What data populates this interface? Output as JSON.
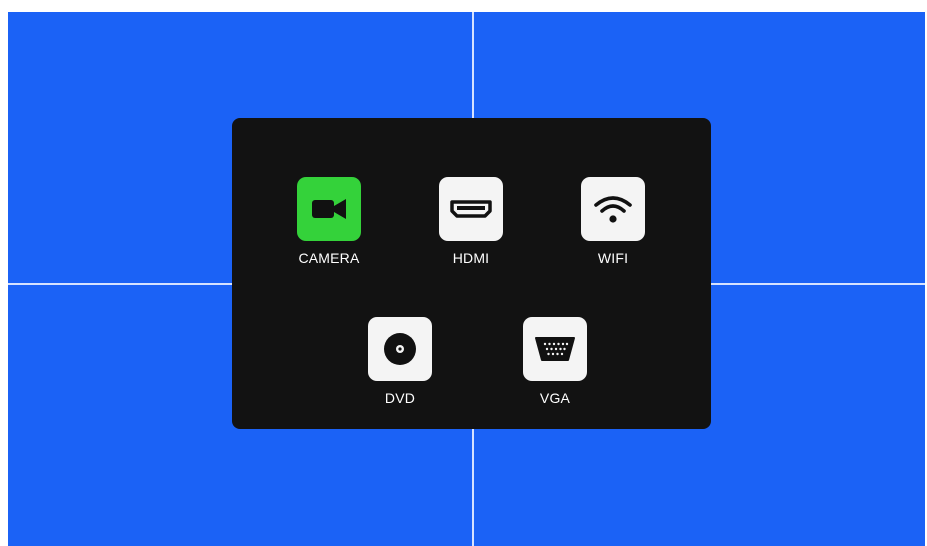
{
  "sources": {
    "selected": "CAMERA",
    "items": [
      {
        "label": "CAMERA",
        "icon": "camera-icon"
      },
      {
        "label": "HDMI",
        "icon": "hdmi-icon"
      },
      {
        "label": "WIFI",
        "icon": "wifi-icon"
      },
      {
        "label": "DVD",
        "icon": "disc-icon"
      },
      {
        "label": "VGA",
        "icon": "vga-port-icon"
      }
    ]
  },
  "colors": {
    "background": "#1b62f6",
    "panel": "#121212",
    "tile": "#f4f4f4",
    "active_tile": "#34d23a",
    "grid_line": "#d6e2ff"
  }
}
